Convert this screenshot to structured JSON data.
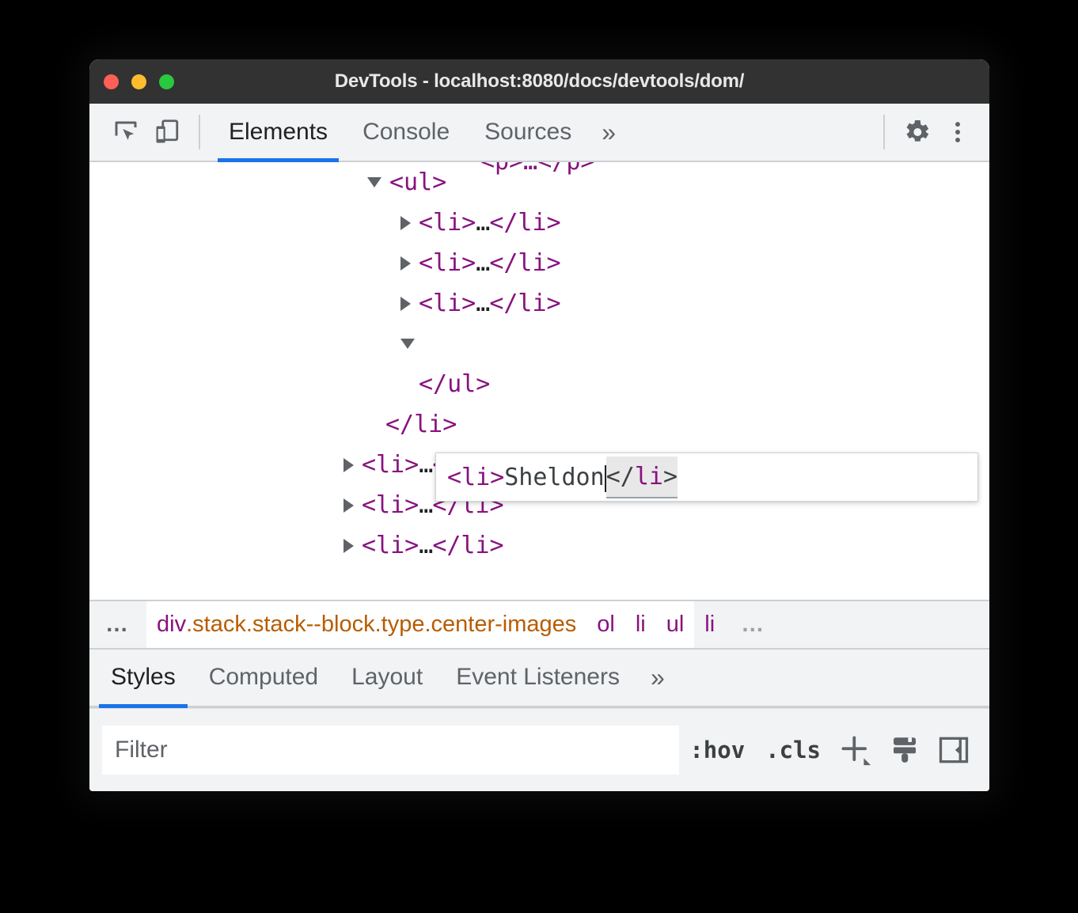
{
  "window": {
    "title": "DevTools - localhost:8080/docs/devtools/dom/",
    "traffic_lights": [
      {
        "name": "close",
        "color": "#ff5f56"
      },
      {
        "name": "minimize",
        "color": "#febc2e"
      },
      {
        "name": "maximize",
        "color": "#28c840"
      }
    ]
  },
  "toolbar": {
    "inspect_icon": "inspect-element-icon",
    "device_icon": "device-toolbar-icon",
    "tabs": [
      {
        "label": "Elements",
        "active": true
      },
      {
        "label": "Console",
        "active": false
      },
      {
        "label": "Sources",
        "active": false
      }
    ],
    "more_tabs": "»",
    "settings_icon": "gear-icon",
    "menu_icon": "kebab-menu-icon"
  },
  "dom_tree": {
    "clipped_top_row": "<p>…</p>",
    "rows": [
      {
        "indent": 1,
        "twisty": "open",
        "text": "<ul>"
      },
      {
        "indent": 2,
        "twisty": "closed",
        "prefix": "<li>",
        "ellipsis": "…",
        "suffix": "</li>"
      },
      {
        "indent": 2,
        "twisty": "closed",
        "prefix": "<li>",
        "ellipsis": "…",
        "suffix": "</li>"
      },
      {
        "indent": 2,
        "twisty": "closed",
        "prefix": "<li>",
        "ellipsis": "…",
        "suffix": "</li>"
      },
      {
        "indent": 2,
        "twisty": "open",
        "text": ""
      },
      {
        "indent": 2,
        "twisty": "blank",
        "text": "</ul>"
      },
      {
        "indent": 1,
        "twisty": "blank",
        "text": "</li>"
      },
      {
        "indent": 1,
        "twisty": "closed",
        "prefix": "<li>",
        "ellipsis": "…",
        "suffix": "</li>"
      },
      {
        "indent": 1,
        "twisty": "closed",
        "prefix": "<li>",
        "ellipsis": "…",
        "suffix": "</li>"
      },
      {
        "indent": 1,
        "twisty": "closed",
        "prefix": "<li>",
        "ellipsis": "…",
        "suffix": "</li>"
      }
    ]
  },
  "edit_box": {
    "open_tag": "<li>",
    "text_value": "Sheldon",
    "close_tag_slash": "</",
    "close_tag_name": "li",
    "close_tag_end": ">"
  },
  "breadcrumb": {
    "overflow_left": "…",
    "overflow_right": "…",
    "items": [
      {
        "name": "div",
        "classes": ".stack.stack--block.type.center-images",
        "selected": false
      },
      {
        "name": "ol",
        "classes": "",
        "selected": false
      },
      {
        "name": "li",
        "classes": "",
        "selected": false
      },
      {
        "name": "ul",
        "classes": "",
        "selected": false
      },
      {
        "name": "li",
        "classes": "",
        "selected": true
      }
    ]
  },
  "styles_pane": {
    "tabs": [
      {
        "label": "Styles",
        "active": true
      },
      {
        "label": "Computed",
        "active": false
      },
      {
        "label": "Layout",
        "active": false
      },
      {
        "label": "Event Listeners",
        "active": false
      }
    ],
    "more_tabs": "»",
    "filter_placeholder": "Filter",
    "filter_value": "",
    "hov_label": ":hov",
    "cls_label": ".cls",
    "new_rule_icon": "plus-icon",
    "copy_styles_icon": "paintbrush-icon",
    "toggle_sidebar_icon": "collapse-sidebar-icon"
  },
  "colors": {
    "accent": "#1a73e8",
    "tag": "#881280",
    "class": "#b85c00",
    "chrome": "#f1f3f4",
    "titlebar": "#323232"
  }
}
